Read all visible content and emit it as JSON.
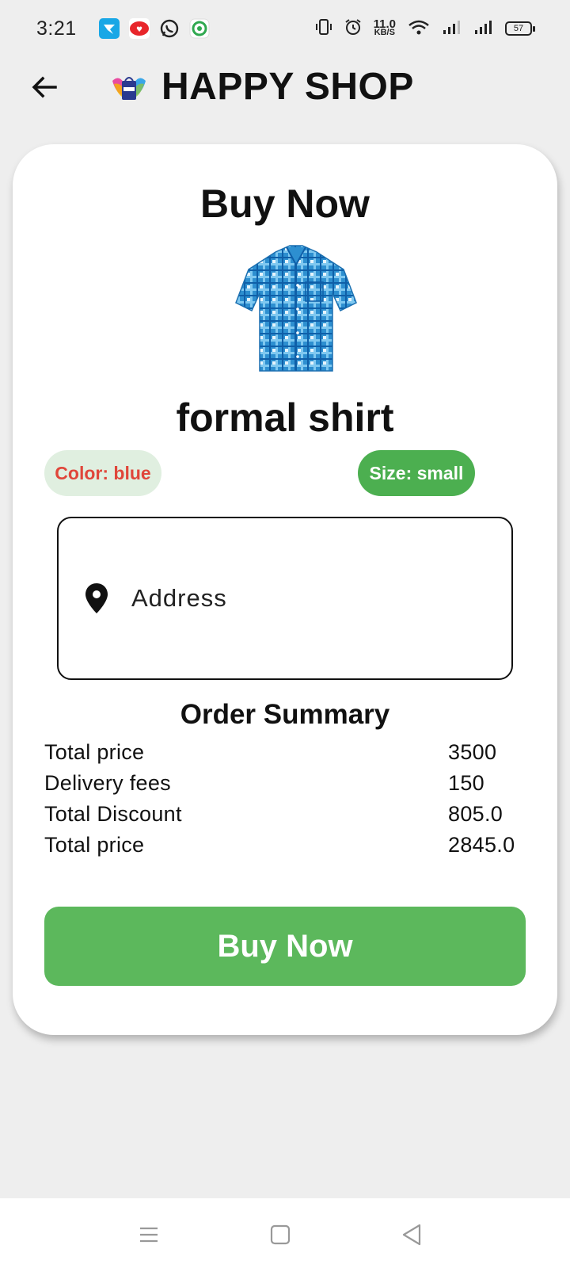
{
  "status_bar": {
    "time": "3:21",
    "speed_value": "11.0",
    "speed_unit": "KB/S",
    "battery": "57",
    "notification_icons": [
      "telenor-icon",
      "app-icon",
      "whatsapp-icon",
      "green-app-icon"
    ]
  },
  "app_bar": {
    "title": "HAPPY SHOP",
    "back_icon": "arrow-left-icon",
    "logo_icon": "shop-logo-icon"
  },
  "card": {
    "title": "Buy Now",
    "product_name": "formal shirt",
    "color_chip": "Color: blue",
    "size_chip": "Size: small",
    "address_placeholder": "Address",
    "address_value": "",
    "location_icon": "location-pin-icon"
  },
  "order_summary": {
    "title": "Order Summary",
    "rows": [
      {
        "label": "Total price",
        "value": "3500"
      },
      {
        "label": "Delivery fees",
        "value": "150"
      },
      {
        "label": "Total Discount",
        "value": "805.0"
      },
      {
        "label": "Total price",
        "value": "2845.0"
      }
    ]
  },
  "buy_button": {
    "label": "Buy Now"
  },
  "colors": {
    "accent_green": "#5cb85c",
    "size_chip_green": "#4caf50",
    "color_chip_bg": "#e0efe0",
    "color_chip_text": "#e0463a",
    "background": "#eeeeee"
  },
  "nav_bar": {
    "icons": [
      "menu-icon",
      "home-square-icon",
      "back-triangle-icon"
    ]
  }
}
